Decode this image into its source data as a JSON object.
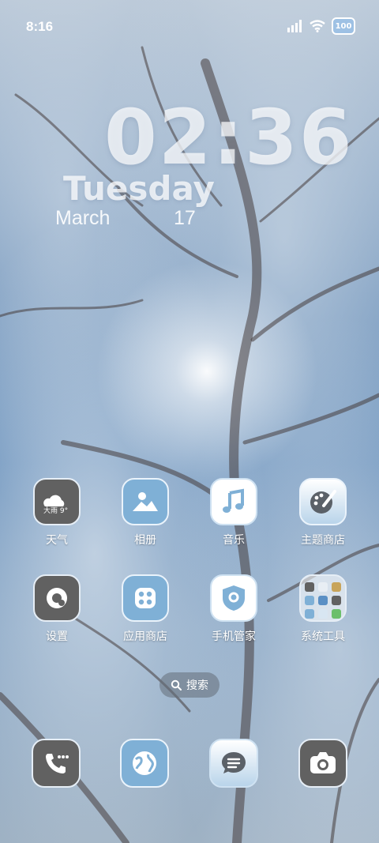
{
  "status_bar": {
    "time": "8:16",
    "battery": "100",
    "icons": [
      "signal-icon",
      "wifi-icon",
      "battery-icon"
    ]
  },
  "lock_widget": {
    "time": "02:36",
    "day": "Tuesday",
    "month": "March",
    "date": "17"
  },
  "apps": [
    {
      "label": "天气",
      "icon": "weather-icon",
      "badge": "大雨 9°"
    },
    {
      "label": "相册",
      "icon": "gallery-icon"
    },
    {
      "label": "音乐",
      "icon": "music-icon"
    },
    {
      "label": "主题商店",
      "icon": "theme-store-icon"
    },
    {
      "label": "设置",
      "icon": "settings-icon"
    },
    {
      "label": "应用商店",
      "icon": "app-store-icon"
    },
    {
      "label": "手机管家",
      "icon": "phone-manager-icon"
    },
    {
      "label": "系统工具",
      "icon": "system-tools-folder-icon"
    }
  ],
  "search": {
    "label": "搜索",
    "icon": "search-icon"
  },
  "dock": [
    {
      "icon": "phone-icon"
    },
    {
      "icon": "browser-icon"
    },
    {
      "icon": "messages-icon"
    },
    {
      "icon": "camera-icon"
    }
  ],
  "colors": {
    "sky": "#5a86b5",
    "icon_dark": "#616161",
    "icon_light": "#7fb0d6"
  }
}
